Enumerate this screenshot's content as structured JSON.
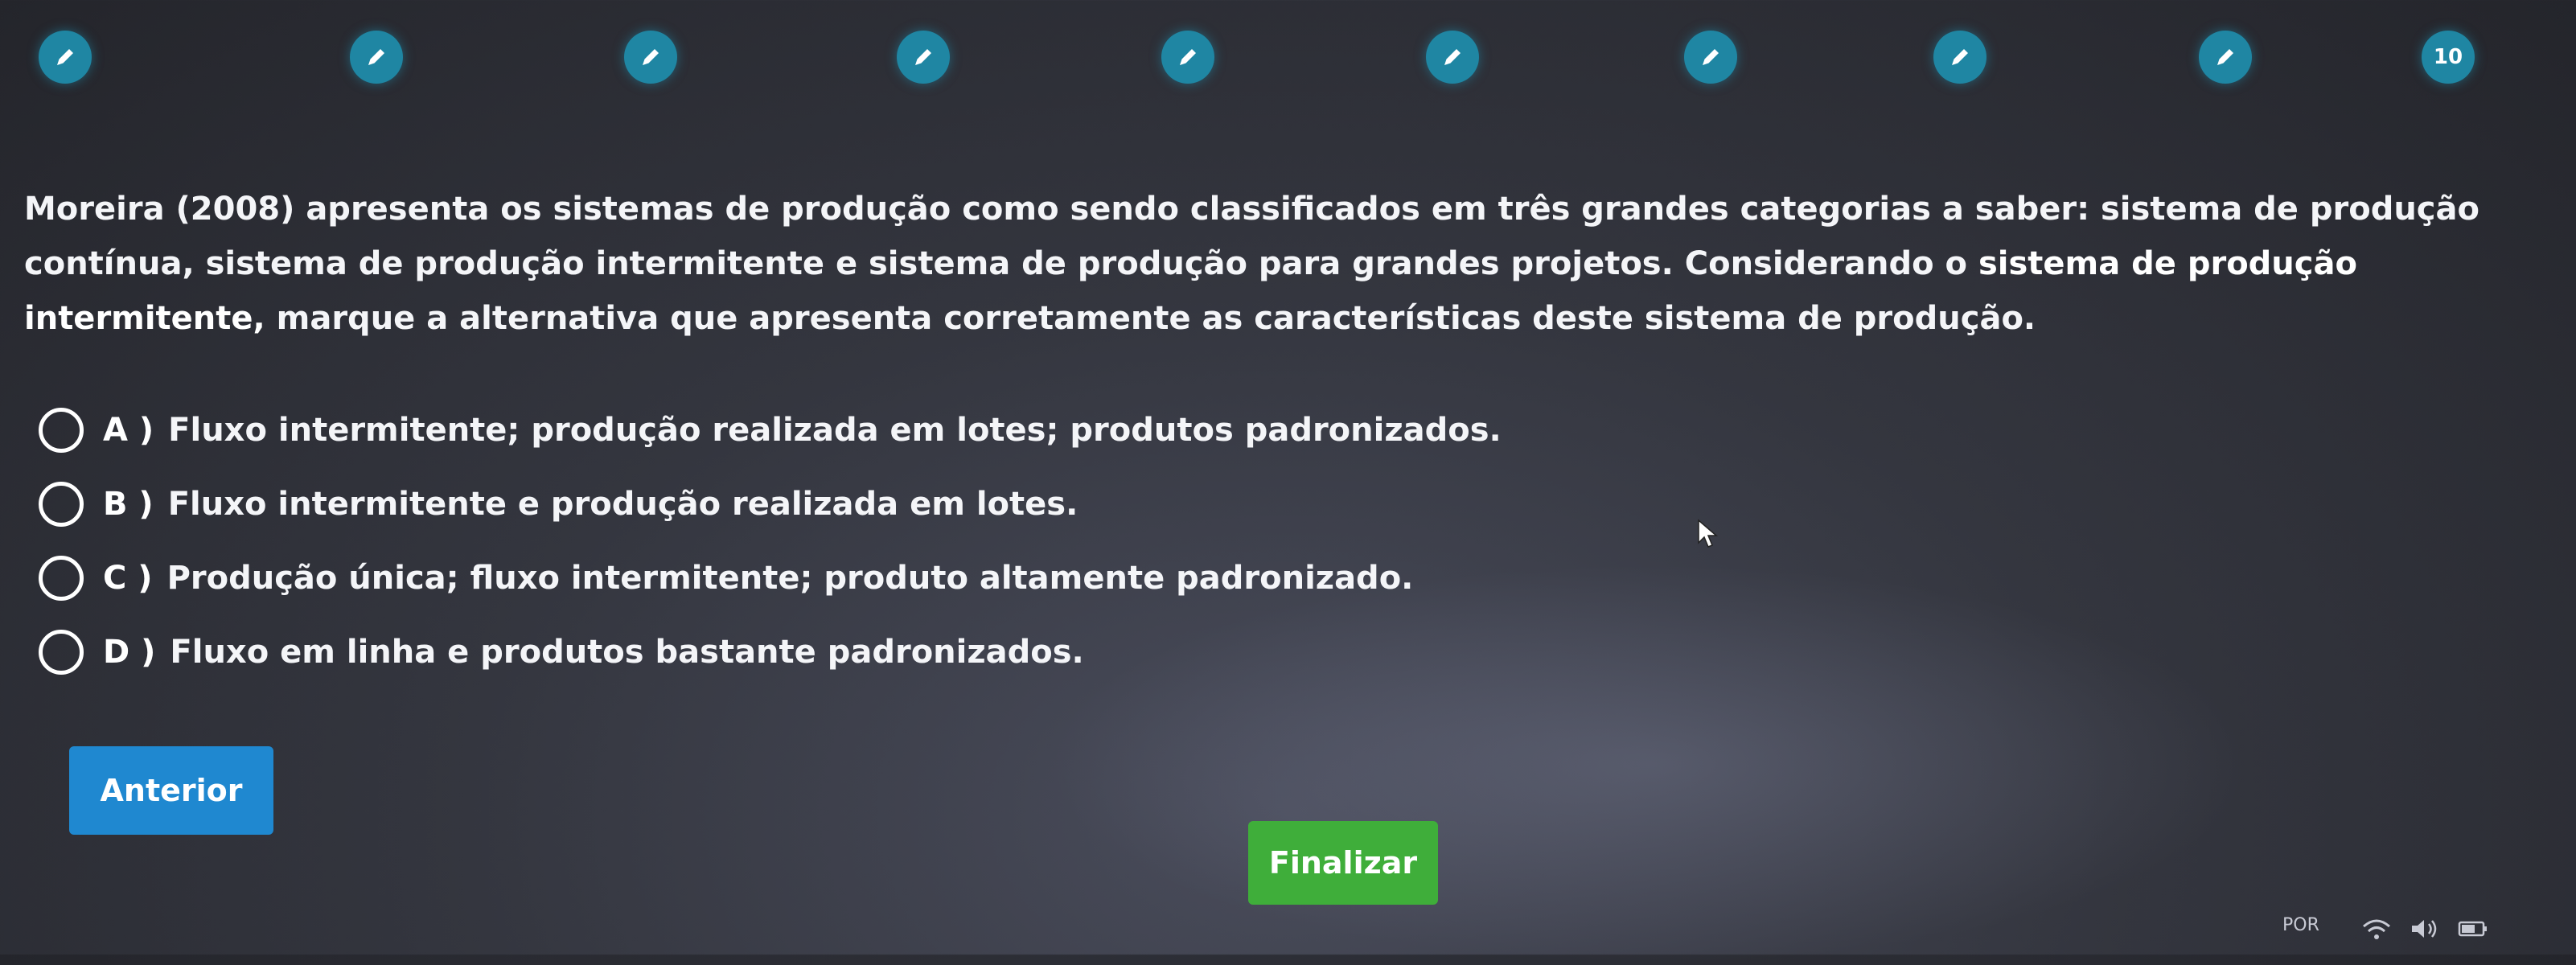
{
  "stepper": {
    "steps": [
      {
        "icon": "pencil-icon",
        "label": ""
      },
      {
        "icon": "pencil-icon",
        "label": ""
      },
      {
        "icon": "pencil-icon",
        "label": ""
      },
      {
        "icon": "pencil-icon",
        "label": ""
      },
      {
        "icon": "pencil-icon",
        "label": ""
      },
      {
        "icon": "pencil-icon",
        "label": ""
      },
      {
        "icon": "pencil-icon",
        "label": ""
      },
      {
        "icon": "pencil-icon",
        "label": ""
      },
      {
        "icon": "pencil-icon",
        "label": ""
      },
      {
        "icon": "",
        "label": "10"
      }
    ],
    "color": "#1f86a3"
  },
  "question": {
    "text_before": "Moreira (2008) apresenta os sistemas de produção como sendo classificados em três grandes categorias a saber: sistema de produção contínua, sistema de produção intermitente e sistema de produção para grandes projetos. Considerando o ",
    "text_strong": "sistema de produção intermitente,",
    "text_after": " marque a alternativa que apresenta corretamente as características deste sistema de produção."
  },
  "options": [
    {
      "letter": "A )",
      "text": "Fluxo intermitente; produção realizada em lotes; produtos padronizados."
    },
    {
      "letter": "B )",
      "text": "Fluxo intermitente e produção realizada em lotes."
    },
    {
      "letter": "C )",
      "text": "Produção única; fluxo intermitente; produto altamente padronizado."
    },
    {
      "letter": "D )",
      "text": "Fluxo em linha e produtos bastante padronizados."
    }
  ],
  "buttons": {
    "previous_label": "Anterior",
    "previous_color": "#1f88d0",
    "finish_label": "Finalizar",
    "finish_color": "#3fae3a"
  },
  "taskbar": {
    "language": "POR"
  }
}
